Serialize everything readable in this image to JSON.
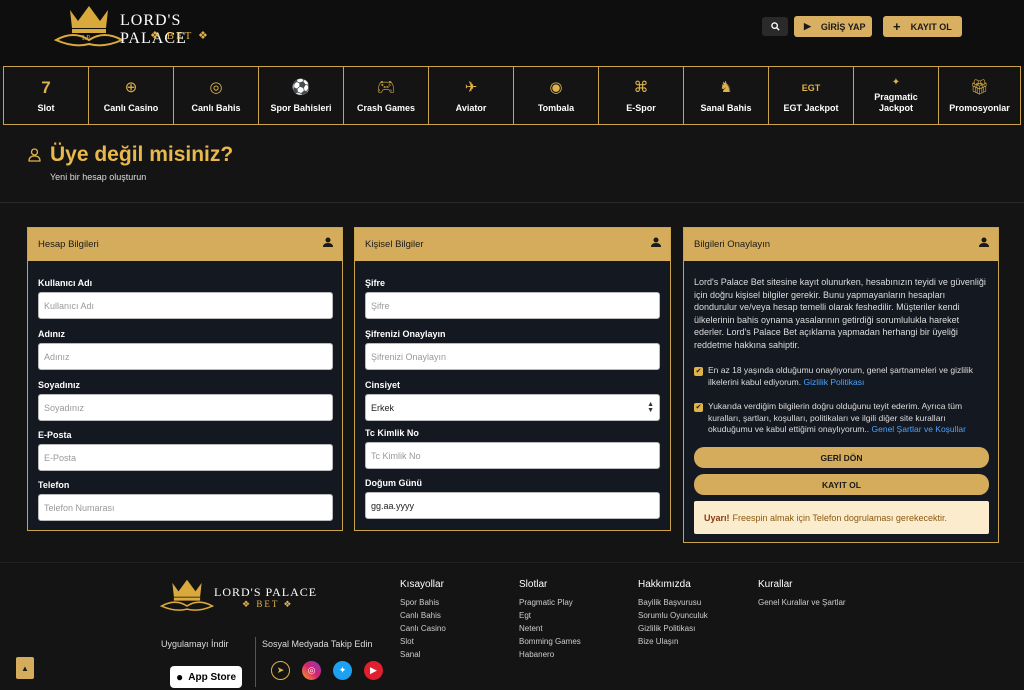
{
  "brand": {
    "name_line1": "LORD'S PALACE",
    "name_line2": "BET"
  },
  "header": {
    "login_label": "GİRİŞ YAP",
    "register_label": "KAYIT OL"
  },
  "nav": [
    {
      "label": "Slot",
      "icon": "seven-icon"
    },
    {
      "label": "Canlı Casino",
      "icon": "roulette-icon"
    },
    {
      "label": "Canlı Bahis",
      "icon": "live-bet-icon"
    },
    {
      "label": "Spor Bahisleri",
      "icon": "sports-icon"
    },
    {
      "label": "Crash Games",
      "icon": "gamepad-icon"
    },
    {
      "label": "Aviator",
      "icon": "plane-icon"
    },
    {
      "label": "Tombala",
      "icon": "bingo-icon"
    },
    {
      "label": "E-Spor",
      "icon": "esports-icon"
    },
    {
      "label": "Sanal Bahis",
      "icon": "horse-icon"
    },
    {
      "label": "EGT Jackpot",
      "icon": "egt-icon"
    },
    {
      "label": "Pragmatic Jackpot",
      "icon": "pragmatic-icon"
    },
    {
      "label": "Promosyonlar",
      "icon": "gift-icon"
    }
  ],
  "page": {
    "title": "Üye değil misiniz?",
    "subtitle": "Yeni bir hesap oluşturun"
  },
  "account": {
    "header": "Hesap Bilgileri",
    "fields": [
      {
        "label": "Kullanıcı Adı",
        "placeholder": "Kullanıcı Adı"
      },
      {
        "label": "Adınız",
        "placeholder": "Adınız"
      },
      {
        "label": "Soyadınız",
        "placeholder": "Soyadınız"
      },
      {
        "label": "E-Posta",
        "placeholder": "E-Posta"
      },
      {
        "label": "Telefon",
        "placeholder": "Telefon Numarası"
      }
    ]
  },
  "personal": {
    "header": "Kişisel Bilgiler",
    "password": {
      "label": "Şifre",
      "placeholder": "Şifre"
    },
    "password_confirm": {
      "label": "Şifrenizi Onaylayın",
      "placeholder": "Şifrenizi Onaylayın"
    },
    "gender": {
      "label": "Cinsiyet",
      "value": "Erkek"
    },
    "tc": {
      "label": "Tc Kimlik No",
      "placeholder": "Tc Kimlik No"
    },
    "birth": {
      "label": "Doğum Günü",
      "value": "gg.aa.yyyy"
    }
  },
  "confirm": {
    "header": "Bilgileri Onaylayın",
    "text": "Lord's Palace Bet sitesine kayıt olunurken, hesabınızın teyidi ve güvenliği için doğru kişisel bilgiler gerekir. Bunu yapmayanların hesapları dondurulur ve/veya hesap temelli olarak feshedilir. Müşteriler kendi ülkelerinin bahis oynama yasalarının getirdiği sorumlulukla hareket ederler. Lord's Palace Bet açıklama yapmadan herhangi bir üyeliği reddetme hakkına sahiptir.",
    "check1_text": "En az 18 yaşında olduğumu onaylıyorum, genel şartnameleri ve gizlilik ilkelerini kabul ediyorum.",
    "check1_link": "Gizlilik Politikası",
    "check2_text": "Yukarıda verdiğim bilgilerin doğru olduğunu teyit ederim. Ayrıca tüm kuralları, şartları, koşulları, politikaları ve ilgili diğer site kuralları okuduğumu ve kabul ettiğimi onaylıyorum..",
    "check2_link": "Genel Şartlar ve Koşullar",
    "back_label": "GERİ DÖN",
    "register_label": "KAYIT OL",
    "warn_bold": "Uyarı!",
    "warn_text": "Freespin almak için Telefon dogrulaması gerekecektir."
  },
  "footer": {
    "app_label": "Uygulamayı İndir",
    "appstore_label": "App Store",
    "social_label": "Sosyal Medyada Takip Edin",
    "cols": [
      {
        "title": "Kısayollar",
        "links": [
          "Spor Bahis",
          "Canlı Bahis",
          "Canlı Casino",
          "Slot",
          "Sanal"
        ]
      },
      {
        "title": "Slotlar",
        "links": [
          "Pragmatic Play",
          "Egt",
          "Netent",
          "Bomming Games",
          "Habanero"
        ]
      },
      {
        "title": "Hakkımızda",
        "links": [
          "Bayilik Başvurusu",
          "Sorumlu Oyunculuk",
          "Gizlilik Politikası",
          "Bize Ulaşın"
        ]
      },
      {
        "title": "Kurallar",
        "links": [
          "Genel Kurallar ve Şartlar"
        ]
      }
    ]
  }
}
